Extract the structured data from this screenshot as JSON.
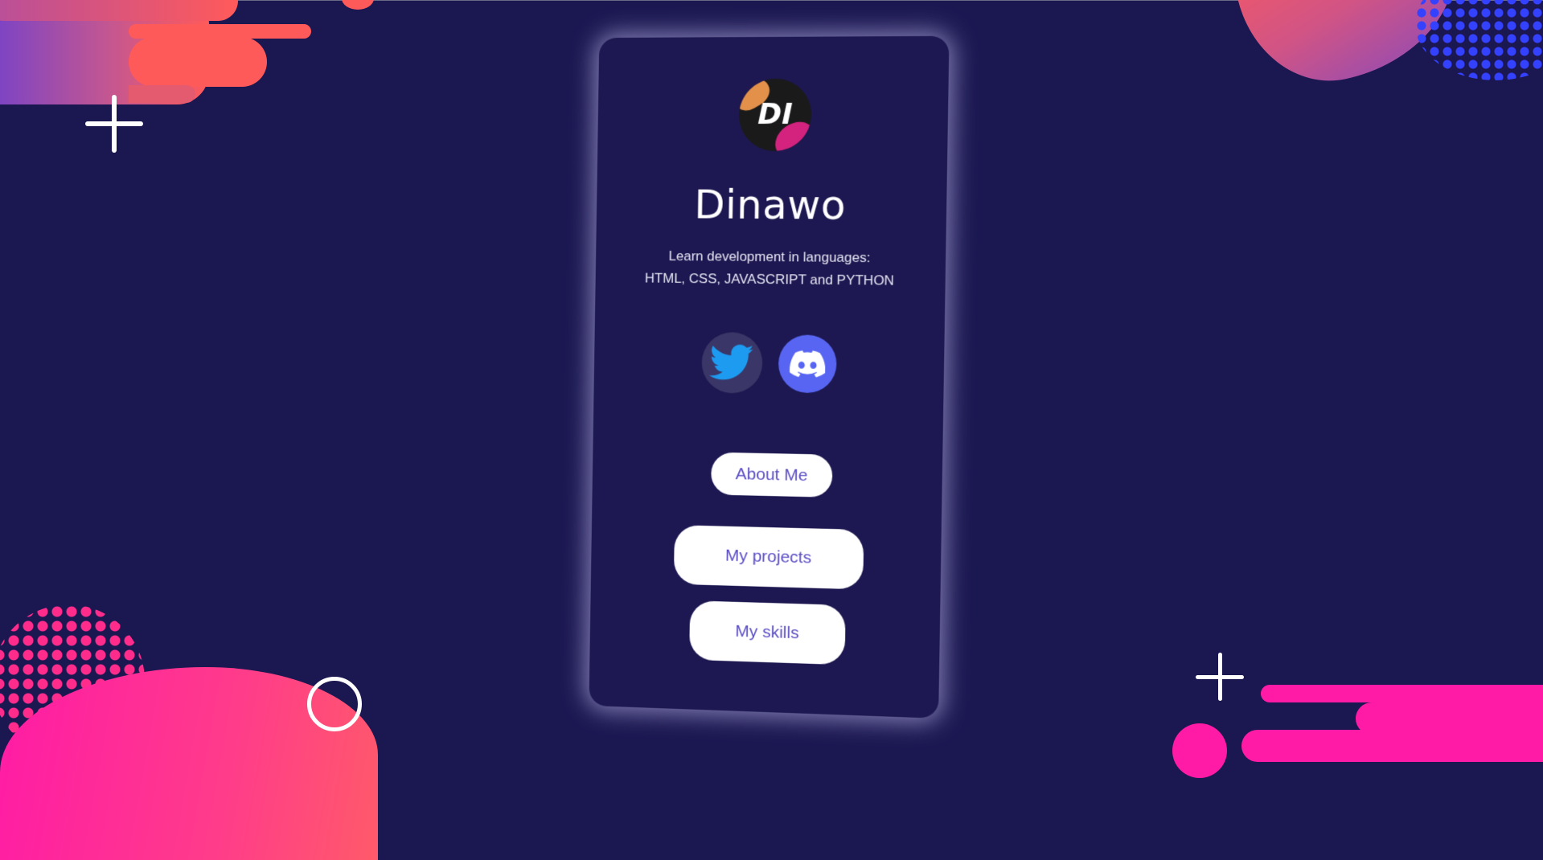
{
  "profile": {
    "logo_text": "DI",
    "name": "Dinawo",
    "description_line1": "Learn development in languages:",
    "description_line2": "HTML, CSS, JAVASCRIPT and PYTHON"
  },
  "socials": [
    {
      "name": "twitter",
      "icon": "twitter-icon",
      "color": "#1d9bf0"
    },
    {
      "name": "discord",
      "icon": "discord-icon",
      "color": "#5865f2"
    }
  ],
  "buttons": {
    "about": "About Me",
    "projects": "My projects",
    "skills": "My skills"
  },
  "colors": {
    "background": "#1b1751",
    "card": "#1d1851",
    "accent_pink": "#ff1ba6",
    "accent_coral": "#ff5a5a",
    "accent_blue": "#3441ff",
    "button_text": "#5b4ec4"
  }
}
